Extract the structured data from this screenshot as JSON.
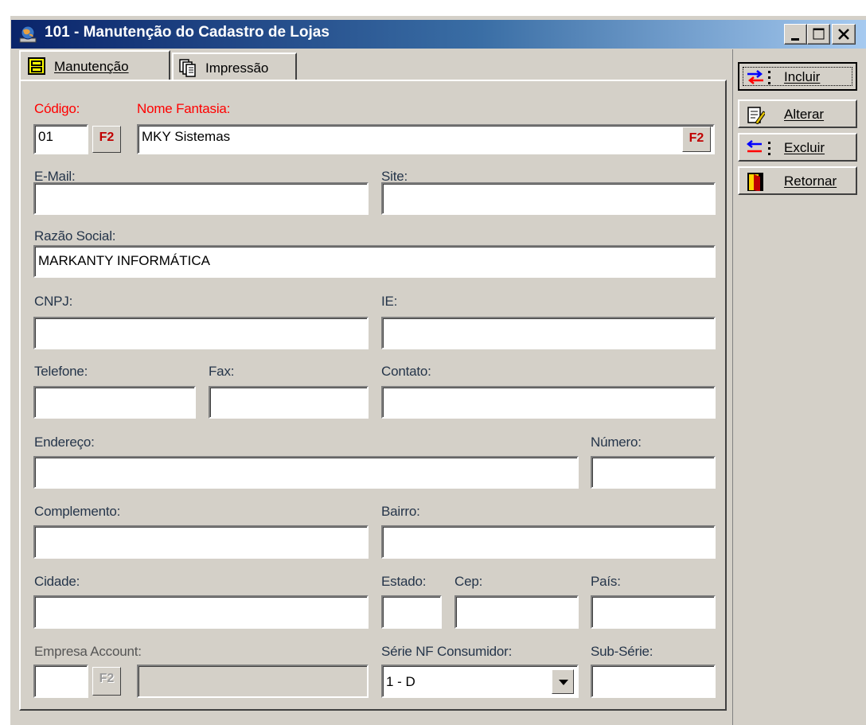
{
  "window": {
    "title": "101 - Manutenção do Cadastro de Lojas",
    "controls": {
      "minimize": "minimize-icon",
      "maximize": "maximize-icon",
      "close": "close-icon"
    }
  },
  "tabs": [
    {
      "label": "Manutenção",
      "icon": "cabinet-icon",
      "active": true
    },
    {
      "label": "Impressão",
      "icon": "print-documents-icon",
      "active": false
    }
  ],
  "form": {
    "codigo": {
      "label": "Código:",
      "value": "01"
    },
    "nome_fantasia": {
      "label": "Nome Fantasia:",
      "value": "MKY Sistemas"
    },
    "email": {
      "label": "E-Mail:",
      "value": ""
    },
    "site": {
      "label": "Site:",
      "value": ""
    },
    "razao_social": {
      "label": "Razão Social:",
      "value": "MARKANTY INFORMÁTICA"
    },
    "cnpj": {
      "label": "CNPJ:",
      "value": ""
    },
    "ie": {
      "label": "IE:",
      "value": ""
    },
    "telefone": {
      "label": "Telefone:",
      "value": ""
    },
    "fax": {
      "label": "Fax:",
      "value": ""
    },
    "contato": {
      "label": "Contato:",
      "value": ""
    },
    "endereco": {
      "label": "Endereço:",
      "value": ""
    },
    "numero": {
      "label": "Número:",
      "value": ""
    },
    "complemento": {
      "label": "Complemento:",
      "value": ""
    },
    "bairro": {
      "label": "Bairro:",
      "value": ""
    },
    "cidade": {
      "label": "Cidade:",
      "value": ""
    },
    "estado": {
      "label": "Estado:",
      "value": ""
    },
    "cep": {
      "label": "Cep:",
      "value": ""
    },
    "pais": {
      "label": "País:",
      "value": ""
    },
    "empresa_account": {
      "label": "Empresa Account:",
      "value": "",
      "name_value": ""
    },
    "serie_nf": {
      "label": "Série NF Consumidor:",
      "value": "1 - D"
    },
    "sub_serie": {
      "label": "Sub-Série:",
      "value": ""
    },
    "f2_label": "F2"
  },
  "actions": [
    {
      "label": "Incluir",
      "icon": "add-record-icon"
    },
    {
      "label": "Alterar",
      "icon": "edit-record-icon"
    },
    {
      "label": "Excluir",
      "icon": "delete-record-icon"
    },
    {
      "label": "Retornar",
      "icon": "exit-door-icon"
    }
  ],
  "colors": {
    "required_label": "#ff0000",
    "title_gradient_start": "#0a246a",
    "title_gradient_end": "#a6caf0",
    "face": "#d4d0c8"
  }
}
